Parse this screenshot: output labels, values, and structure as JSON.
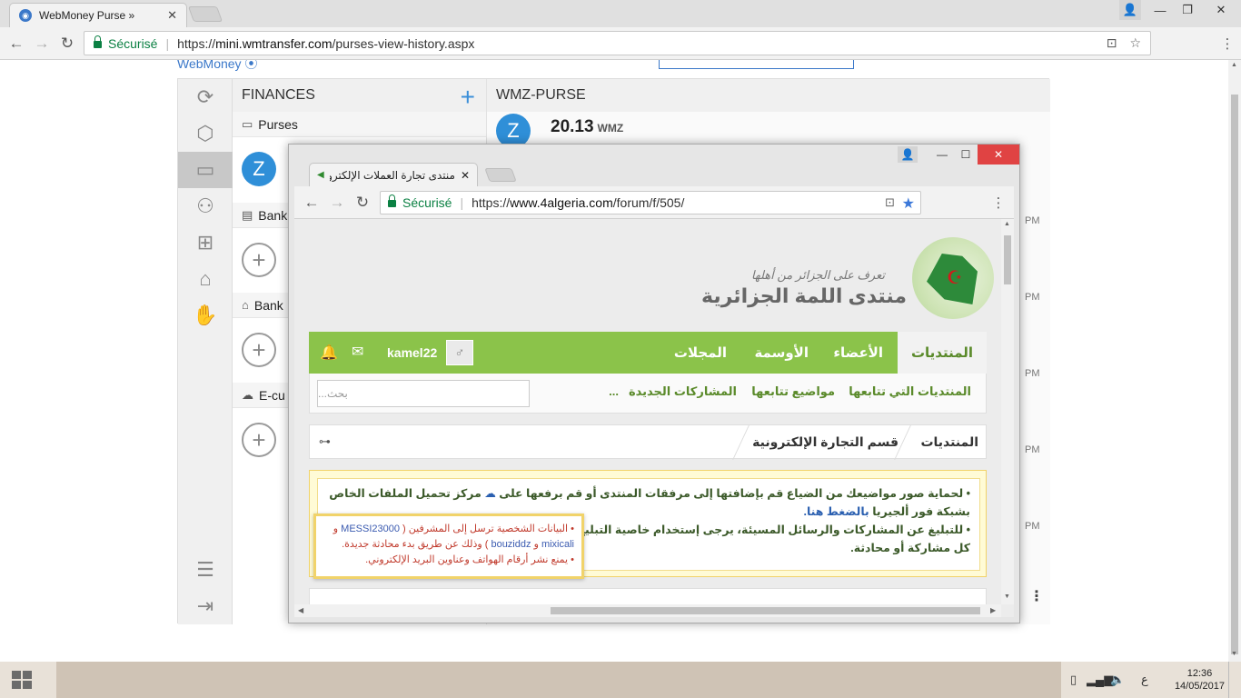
{
  "browser": {
    "tab_title": "WebMoney Purse »",
    "secure_label": "Sécurisé",
    "url_scheme": "https://",
    "url_domain": "mini.wmtransfer.com",
    "url_path": "/purses-view-history.aspx",
    "icons": [
      "back-icon",
      "forward-icon",
      "reload-icon",
      "translate-icon",
      "star-icon",
      "menu-icon"
    ]
  },
  "webmoney": {
    "finances_title": "FINANCES",
    "purses_label": "Purses",
    "purse_initial": "Z",
    "bank1_label": "Bank",
    "bank2_label": "Bank",
    "ecur_label": "E-cu",
    "purse_title": "WMZ-PURSE",
    "amount": "20.13",
    "currency": "WMZ",
    "pm_labels": [
      "PM",
      "PM",
      "PM",
      "PM",
      "PM",
      "PM"
    ],
    "accent": "#2f8fd8"
  },
  "popup": {
    "tab_title": "منتدى تجارة العملات الإلكترونية",
    "secure_label": "Sécurisé",
    "url_scheme": "https://",
    "url_domain": "www.4algeria.com",
    "url_path": "/forum/f/505/",
    "logo_title": "منتدى اللمة الجزائرية",
    "logo_subtitle": "تعرف على الجزائر من أهلها",
    "nav": {
      "forums": "المنتديات",
      "members": "الأعضاء",
      "badges": "الأوسمة",
      "magazines": "المجلات",
      "username": "kamel22"
    },
    "subnav": {
      "followed_forums": "المنتديات التي تتابعها",
      "followed_topics": "مواضيع تتابعها",
      "new_posts": "المشاركات الجديدة",
      "more": "...",
      "search_placeholder": "بحث..."
    },
    "breadcrumb": {
      "root": "المنتديات",
      "section": "قسم التجارة الإلكترونية"
    },
    "notice": {
      "line1_a": "• لحماية صور مواضيعك من الضياع قم بإضافتها إلى مرفقات المنتدى أو قم برفعها على",
      "line1_b": "مركز تحميل الملفات الخاص",
      "line2_a": "بشبكة فور ألجيريا",
      "line2_link": "بالضغط هنا.",
      "line3": "• للتبليغ عن المشاركات والرسائل المسيئة، يرجى إستخدام خاصية التبليغ و",
      "line4": "كل مشاركة أو محادثة."
    },
    "tooltip": {
      "line1_a": "• البيانات الشخصية ترسل إلى المشرفين (",
      "mod1": "MESSI23000",
      "line1_b": "و",
      "mod2": "mixicali",
      "line2_a": "و",
      "mod3": "bouziddz",
      "line2_b": ") وذلك عن طريق بدء محادثة جديدة.",
      "line3": "• يمنع نشر أرقام الهواتف وعناوين البريد الإلكتروني."
    },
    "colors": {
      "nav_green": "#8bc34a",
      "text_green": "#5a8a2a",
      "notice_border": "#f1d36a"
    }
  },
  "taskbar": {
    "time": "12:36",
    "date": "14/05/2017",
    "lang": "ع"
  }
}
